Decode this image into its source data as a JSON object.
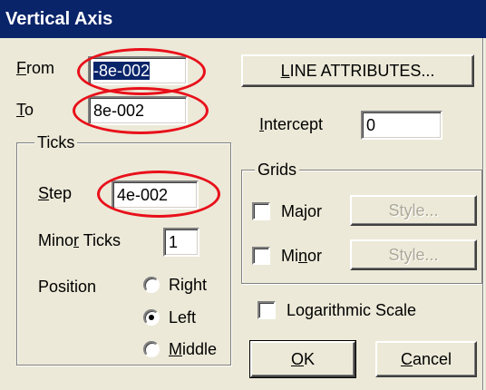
{
  "window": {
    "title": "Vertical Axis"
  },
  "range": {
    "from_label": "From",
    "from_mnemonic": "F",
    "from_rest": "rom",
    "from_value": "-8e-002",
    "to_label": "To",
    "to_mnemonic": "T",
    "to_rest": "o",
    "to_value": "8e-002"
  },
  "ticks": {
    "group_title": "Ticks",
    "step_mnemonic": "S",
    "step_rest": "tep",
    "step_value": "4e-002",
    "minor_pre": "Mino",
    "minor_mnemonic": "r",
    "minor_post": " Ticks",
    "minor_value": "1",
    "position_label": "Position",
    "options": [
      {
        "label": "Right",
        "checked": false
      },
      {
        "label": "Left",
        "checked": true
      },
      {
        "label": "Middle",
        "mnemonic": "M",
        "rest": "iddle",
        "checked": false
      }
    ]
  },
  "line_attributes": {
    "mnemonic": "L",
    "rest": "INE ATTRIBUTES..."
  },
  "intercept": {
    "mnemonic": "I",
    "rest": "ntercept",
    "value": "0"
  },
  "grids": {
    "group_title": "Grids",
    "major_label": "Major",
    "major_checked": false,
    "major_style": "Style...",
    "minor_pre": "Mi",
    "minor_mnemonic": "n",
    "minor_post": "or",
    "minor_checked": false,
    "minor_style": "Style..."
  },
  "log_scale": {
    "label": "Logarithmic Scale",
    "checked": false
  },
  "buttons": {
    "ok_mnemonic": "O",
    "ok_rest": "K",
    "cancel_mnemonic": "C",
    "cancel_rest": "ancel"
  },
  "colors": {
    "title_bar": "#0a246a",
    "annotation": "#e8101a",
    "dialog_bg": "#ece9d8"
  }
}
